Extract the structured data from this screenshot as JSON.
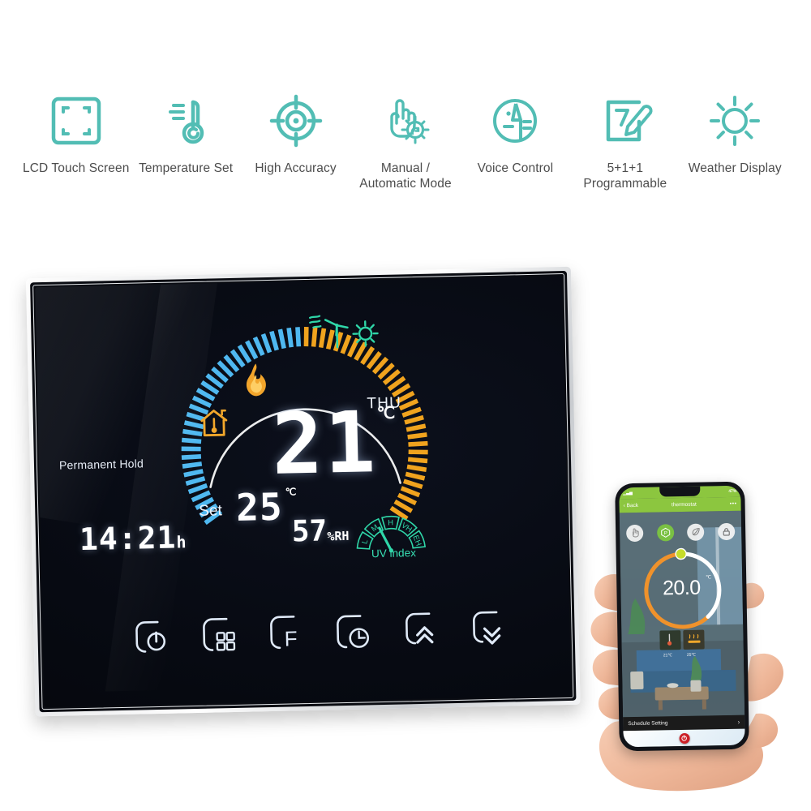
{
  "features": [
    {
      "label": "LCD Touch Screen",
      "icon": "lcd-screen-icon"
    },
    {
      "label": "Temperature Set",
      "icon": "thermometer-icon"
    },
    {
      "label": "High Accuracy",
      "icon": "crosshair-target-icon"
    },
    {
      "label": "Manual /\nAutomatic Mode",
      "icon": "hand-gear-icon"
    },
    {
      "label": "Voice Control",
      "icon": "voice-microphone-icon"
    },
    {
      "label": "5+1+1\nProgrammable",
      "icon": "note-pencil-icon"
    },
    {
      "label": "Weather Display",
      "icon": "sun-icon"
    }
  ],
  "thermostat": {
    "current_temp": "21",
    "current_unit": "℃",
    "set_label": "Set",
    "set_temp": "25",
    "set_unit": "℃",
    "hold_status": "Permanent Hold",
    "clock": "14:21",
    "clock_unit": "h",
    "weekday": "THU",
    "humidity": "57",
    "humidity_unit": "%RH",
    "uv_label": "UV index",
    "uv_segments": [
      "L",
      "M",
      "H",
      "VH",
      "EH"
    ],
    "uv_active": "M",
    "icons": {
      "flame": "flame-heating-icon",
      "house": "house-thermometer-icon",
      "wind": "wind-turbine-icon",
      "sun": "sun-weather-icon"
    },
    "colors": {
      "blue_ticks": "#4fb8f0",
      "orange_ticks": "#f0a31e",
      "teal": "#2fd6a8",
      "amber": "#f2a72b",
      "lcd_white": "#ffffff"
    },
    "touch_buttons": [
      {
        "name": "power-button",
        "glyph": "power"
      },
      {
        "name": "menu-button",
        "glyph": "grid"
      },
      {
        "name": "fahrenheit-button",
        "glyph": "F"
      },
      {
        "name": "timer-button",
        "glyph": "clock"
      },
      {
        "name": "temp-up-button",
        "glyph": "chevron-up"
      },
      {
        "name": "temp-down-button",
        "glyph": "chevron-down"
      }
    ]
  },
  "phone": {
    "status_battery": "47%",
    "back_label": "Back",
    "app_title": "thermostat",
    "menu_glyph": "•••",
    "modes": [
      {
        "name": "manual-mode",
        "glyph": "hand",
        "active": false
      },
      {
        "name": "program-mode",
        "glyph": "P",
        "active": true
      },
      {
        "name": "eco-mode",
        "glyph": "leaf",
        "active": false
      },
      {
        "name": "lock-mode",
        "glyph": "lock",
        "active": false
      }
    ],
    "dial_temp": "20.0",
    "dial_unit": "℃",
    "room_temp": "21℃",
    "floor_temp": "25℃",
    "schedule_label": "Schedule Setting",
    "schedule_arrow": "›",
    "accent_green": "#8cc63f",
    "accent_orange": "#f0922b"
  }
}
